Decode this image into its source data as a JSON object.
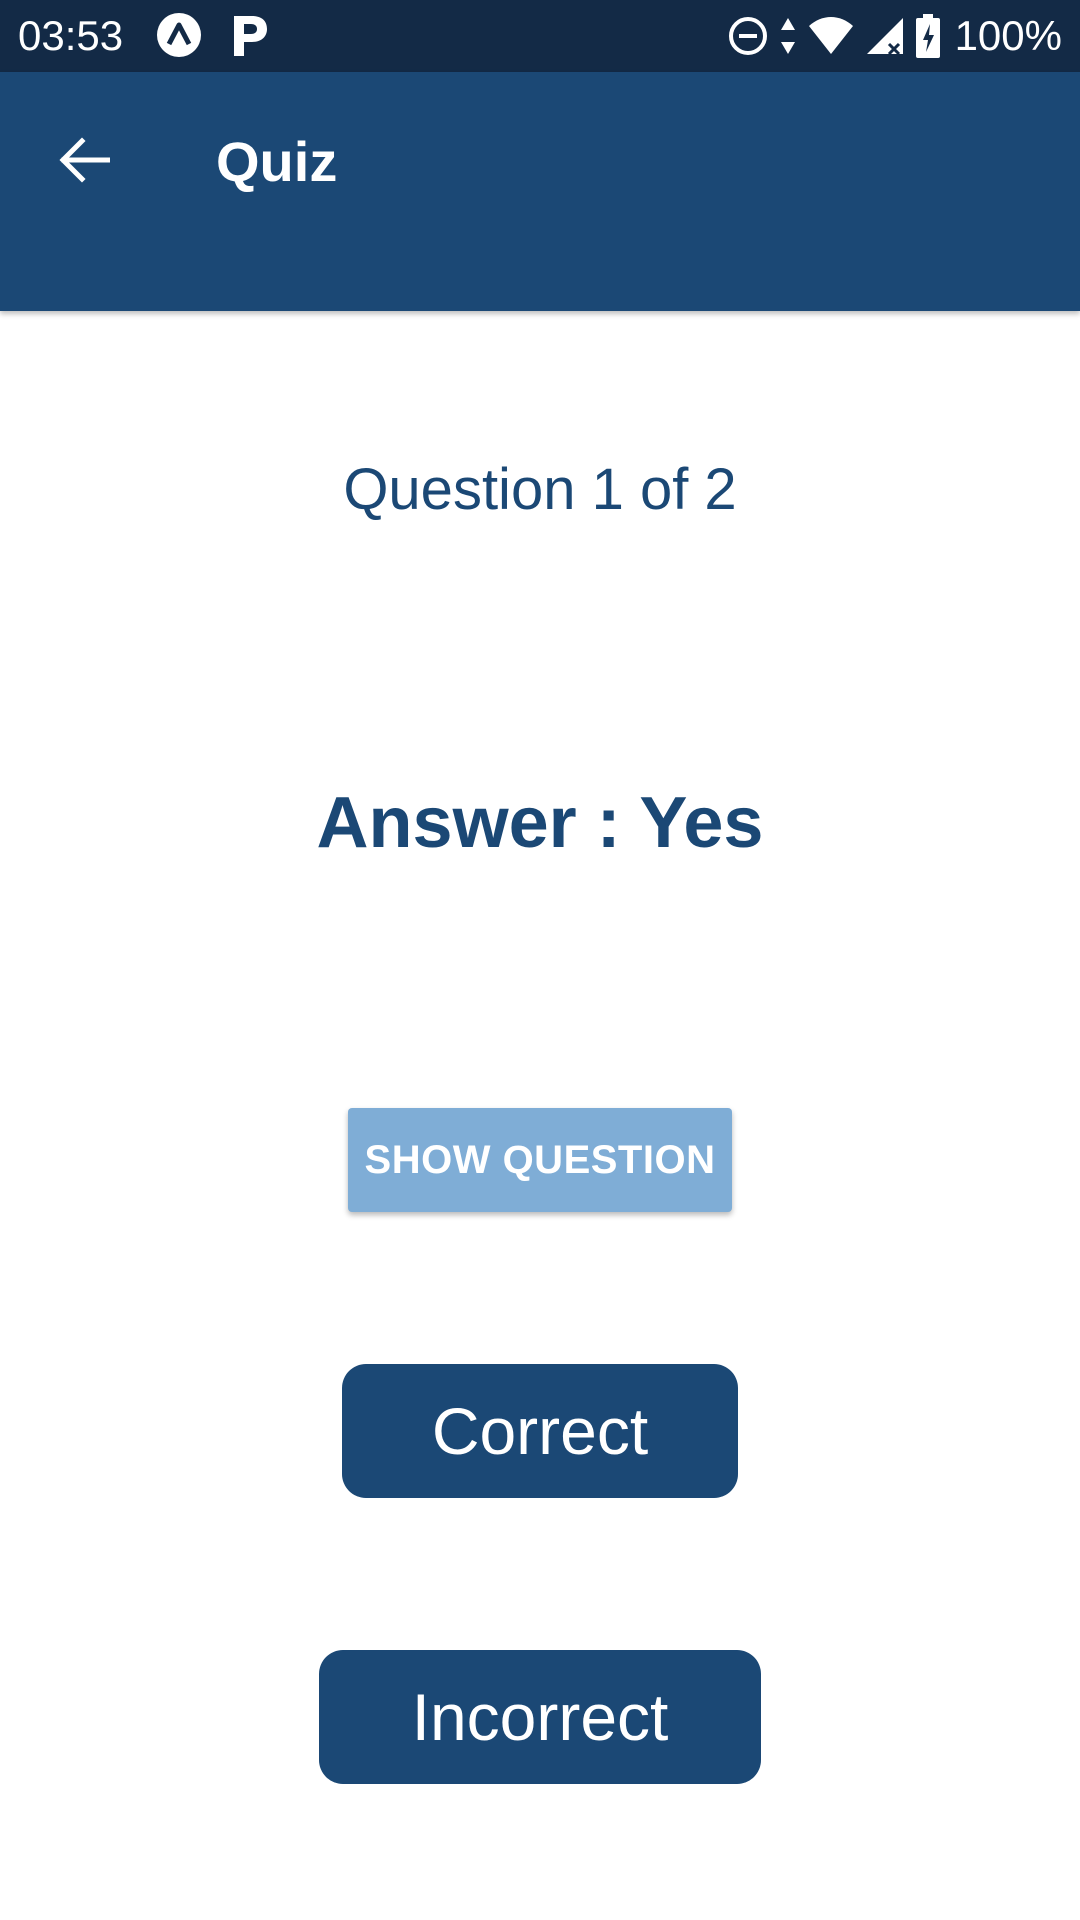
{
  "status_bar": {
    "time": "03:53",
    "battery": "100%",
    "icons": [
      "expo-icon",
      "p-app-icon",
      "do-not-disturb-icon",
      "data-arrows-icon",
      "wifi-icon",
      "signal-icon",
      "battery-charging-icon"
    ]
  },
  "app_bar": {
    "title": "Quiz",
    "back_icon": "arrow-back-icon",
    "background": "#1b4875"
  },
  "quiz": {
    "counter": "Question 1 of 2",
    "answer": "Answer : Yes",
    "show_question_label": "SHOW QUESTION",
    "correct_label": "Correct",
    "incorrect_label": "Incorrect"
  },
  "colors": {
    "primary": "#1b4875",
    "status_bar": "#132a46",
    "secondary_button": "#7fadd6"
  }
}
